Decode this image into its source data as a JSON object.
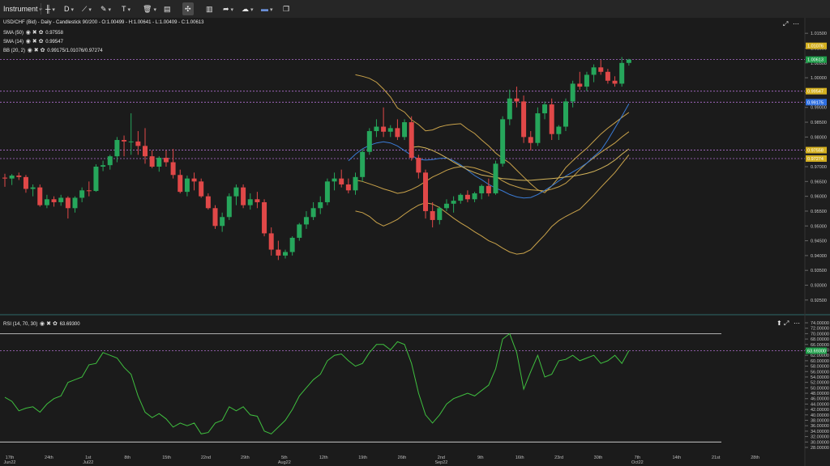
{
  "toolbar": {
    "instrument_label": "Instrument",
    "timeframe_label": "D",
    "icons": [
      "instrument-dropdown",
      "candles-icon",
      "timeframe-dropdown",
      "drawing-line-icon",
      "pencil-icon",
      "text-icon",
      "trash-icon",
      "layout-icon",
      "crosshair-icon",
      "bar-chart-icon",
      "share-icon",
      "weather-icon",
      "flag-uk-icon",
      "window-icon"
    ]
  },
  "colors": {
    "background": "#1b1b1b",
    "up": "#26a65b",
    "down": "#e04848",
    "bb": "#c9a24a",
    "sma50": "#d4b45a",
    "sma14": "#3a7bd5",
    "rsi": "#3fbf3f",
    "hline": "#b070d0"
  },
  "legend": {
    "title": "USD/CHF (Bid) - Daily - Candlestick  90/200 - O:1.00499 - H:1.00641 - L:1.00409 - C:1.00613",
    "sma50": "SMA (50)",
    "sma50_value": "0.97558",
    "sma14": "SMA (14)",
    "sma14_value": "0.99547",
    "bb": "BB (20, 2)",
    "bb_value": "0.99175/1.01076/0.97274",
    "rsi": "RSI (14, 70, 30)",
    "rsi_value": "63.69300"
  },
  "price_axis": {
    "ticks": [
      "1.01500",
      "1.01000",
      "1.00500",
      "1.00000",
      "0.99500",
      "0.99000",
      "0.98500",
      "0.98000",
      "0.97500",
      "0.97000",
      "0.96500",
      "0.96000",
      "0.95500",
      "0.95000",
      "0.94500",
      "0.94000",
      "0.93500",
      "0.93000",
      "0.92500"
    ],
    "badges": [
      {
        "text": "1.01076",
        "value": 1.01076,
        "color": "#d4b020"
      },
      {
        "text": "1.00613",
        "value": 1.00613,
        "color": "#1f9e4a"
      },
      {
        "text": "0.99547",
        "value": 0.99547,
        "color": "#d4b020"
      },
      {
        "text": "0.99175",
        "value": 0.99175,
        "color": "#2f6fe0"
      },
      {
        "text": "0.97558",
        "value": 0.97558,
        "color": "#d4b020"
      },
      {
        "text": "0.97274",
        "value": 0.97274,
        "color": "#d4b020"
      }
    ]
  },
  "rsi_axis": {
    "ticks": [
      "74.00000",
      "72.00000",
      "70.00000",
      "68.00000",
      "66.00000",
      "64.00000",
      "62.00000",
      "60.00000",
      "58.00000",
      "56.00000",
      "54.00000",
      "52.00000",
      "50.00000",
      "48.00000",
      "46.00000",
      "44.00000",
      "42.00000",
      "40.00000",
      "38.00000",
      "36.00000",
      "34.00000",
      "32.00000",
      "30.00000",
      "28.00000"
    ],
    "badge": {
      "text": "63.69300",
      "value": 63.693,
      "color": "#1f9e4a"
    }
  },
  "date_axis": {
    "labels": [
      "17th Jun22",
      "24th",
      "1st Jul22",
      "8th",
      "15th",
      "22nd",
      "29th",
      "5th Aug22",
      "12th",
      "19th",
      "26th",
      "2nd Sep22",
      "9th",
      "16th",
      "23rd",
      "30th",
      "7th Oct22",
      "14th",
      "21st",
      "28th"
    ]
  },
  "chart_data": {
    "type": "candlestick",
    "ylim": [
      0.9225,
      1.0175
    ],
    "rsi_ylim": [
      28,
      74
    ],
    "hlines_price": [
      1.00613,
      0.99547,
      0.99175,
      0.97558,
      0.97274
    ],
    "hlines_rsi": [
      70,
      63.693
    ],
    "candles": [
      [
        0.9663,
        0.9676,
        0.9632,
        0.966
      ],
      [
        0.966,
        0.9675,
        0.9638,
        0.967
      ],
      [
        0.967,
        0.968,
        0.9655,
        0.9665
      ],
      [
        0.9665,
        0.9672,
        0.9612,
        0.9625
      ],
      [
        0.9625,
        0.964,
        0.96,
        0.963
      ],
      [
        0.963,
        0.964,
        0.9565,
        0.957
      ],
      [
        0.957,
        0.9605,
        0.956,
        0.959
      ],
      [
        0.959,
        0.96,
        0.9565,
        0.958
      ],
      [
        0.958,
        0.9605,
        0.9568,
        0.9595
      ],
      [
        0.9595,
        0.96,
        0.9525,
        0.956
      ],
      [
        0.956,
        0.96,
        0.9545,
        0.9595
      ],
      [
        0.9595,
        0.963,
        0.958,
        0.962
      ],
      [
        0.962,
        0.965,
        0.96,
        0.9618
      ],
      [
        0.9618,
        0.9708,
        0.9615,
        0.97
      ],
      [
        0.97,
        0.972,
        0.9685,
        0.9705
      ],
      [
        0.9705,
        0.974,
        0.969,
        0.9735
      ],
      [
        0.9735,
        0.98,
        0.9715,
        0.979
      ],
      [
        0.979,
        0.9805,
        0.9735,
        0.9785
      ],
      [
        0.9785,
        0.988,
        0.974,
        0.9785
      ],
      [
        0.9785,
        0.982,
        0.974,
        0.977
      ],
      [
        0.977,
        0.983,
        0.971,
        0.9735
      ],
      [
        0.9735,
        0.9755,
        0.9695,
        0.97
      ],
      [
        0.97,
        0.9735,
        0.9683,
        0.973
      ],
      [
        0.973,
        0.9755,
        0.97,
        0.9715
      ],
      [
        0.9715,
        0.976,
        0.966,
        0.9672
      ],
      [
        0.9672,
        0.969,
        0.961,
        0.9615
      ],
      [
        0.9615,
        0.967,
        0.96,
        0.966
      ],
      [
        0.966,
        0.968,
        0.962,
        0.965
      ],
      [
        0.965,
        0.966,
        0.9595,
        0.96
      ],
      [
        0.96,
        0.961,
        0.9555,
        0.956
      ],
      [
        0.956,
        0.957,
        0.949,
        0.95
      ],
      [
        0.95,
        0.9545,
        0.948,
        0.953
      ],
      [
        0.953,
        0.961,
        0.952,
        0.96
      ],
      [
        0.96,
        0.964,
        0.957,
        0.963
      ],
      [
        0.963,
        0.964,
        0.956,
        0.957
      ],
      [
        0.957,
        0.961,
        0.9555,
        0.959
      ],
      [
        0.959,
        0.9615,
        0.956,
        0.958
      ],
      [
        0.958,
        0.959,
        0.9465,
        0.9475
      ],
      [
        0.9475,
        0.9495,
        0.94,
        0.942
      ],
      [
        0.942,
        0.945,
        0.9385,
        0.94
      ],
      [
        0.94,
        0.942,
        0.939,
        0.9412
      ],
      [
        0.9412,
        0.9465,
        0.94,
        0.946
      ],
      [
        0.946,
        0.951,
        0.945,
        0.9505
      ],
      [
        0.9505,
        0.955,
        0.949,
        0.953
      ],
      [
        0.953,
        0.958,
        0.952,
        0.956
      ],
      [
        0.956,
        0.96,
        0.954,
        0.958
      ],
      [
        0.958,
        0.966,
        0.957,
        0.965
      ],
      [
        0.965,
        0.968,
        0.962,
        0.966
      ],
      [
        0.966,
        0.969,
        0.963,
        0.964
      ],
      [
        0.964,
        0.966,
        0.961,
        0.962
      ],
      [
        0.962,
        0.968,
        0.9605,
        0.9665
      ],
      [
        0.9665,
        0.976,
        0.965,
        0.975
      ],
      [
        0.975,
        0.983,
        0.974,
        0.982
      ],
      [
        0.982,
        0.986,
        0.98,
        0.9835
      ],
      [
        0.9835,
        0.99,
        0.98,
        0.9818
      ],
      [
        0.9818,
        0.984,
        0.98,
        0.983
      ],
      [
        0.983,
        0.986,
        0.979,
        0.98
      ],
      [
        0.98,
        0.986,
        0.979,
        0.985
      ],
      [
        0.985,
        0.987,
        0.972,
        0.973
      ],
      [
        0.973,
        0.974,
        0.966,
        0.968
      ],
      [
        0.968,
        0.969,
        0.9525,
        0.955
      ],
      [
        0.955,
        0.958,
        0.9495,
        0.952
      ],
      [
        0.952,
        0.9565,
        0.9505,
        0.956
      ],
      [
        0.956,
        0.959,
        0.955,
        0.9575
      ],
      [
        0.9575,
        0.96,
        0.9545,
        0.9585
      ],
      [
        0.9585,
        0.961,
        0.9575,
        0.9605
      ],
      [
        0.9605,
        0.962,
        0.958,
        0.959
      ],
      [
        0.959,
        0.9615,
        0.958,
        0.961
      ],
      [
        0.961,
        0.964,
        0.959,
        0.9635
      ],
      [
        0.9635,
        0.966,
        0.96,
        0.961
      ],
      [
        0.961,
        0.972,
        0.9605,
        0.971
      ],
      [
        0.971,
        0.987,
        0.97,
        0.986
      ],
      [
        0.986,
        0.996,
        0.984,
        0.993
      ],
      [
        0.993,
        0.997,
        0.99,
        0.992
      ],
      [
        0.992,
        0.994,
        0.978,
        0.98
      ],
      [
        0.98,
        0.982,
        0.9755,
        0.978
      ],
      [
        0.978,
        0.99,
        0.977,
        0.988
      ],
      [
        0.988,
        0.992,
        0.986,
        0.991
      ],
      [
        0.991,
        0.993,
        0.979,
        0.981
      ],
      [
        0.981,
        0.984,
        0.979,
        0.9835
      ],
      [
        0.9835,
        0.993,
        0.982,
        0.992
      ],
      [
        0.992,
        0.999,
        0.99,
        0.998
      ],
      [
        0.998,
        1.002,
        0.996,
        0.997
      ],
      [
        0.997,
        1.002,
        0.9955,
        1.001
      ],
      [
        1.001,
        1.0045,
        0.9985,
        1.0035
      ],
      [
        1.0035,
        1.006,
        1.001,
        1.002
      ],
      [
        1.002,
        1.003,
        0.998,
        0.999
      ],
      [
        0.999,
        1.0005,
        0.997,
        0.998
      ],
      [
        0.998,
        1.007,
        0.997,
        1.005
      ],
      [
        1.005,
        1.0064,
        1.0041,
        1.00613
      ]
    ],
    "bb_upper": [
      1.001,
      1.0005,
      0.9998,
      0.9985,
      0.9962,
      0.9935,
      0.9898,
      0.9884,
      0.9858,
      0.9842,
      0.9821,
      0.9824,
      0.9834,
      0.984,
      0.9843,
      0.9845,
      0.9827,
      0.9812,
      0.979,
      0.977,
      0.9746,
      0.9728,
      0.9712,
      0.9688,
      0.9665,
      0.9642,
      0.9622,
      0.9612,
      0.9635,
      0.9664,
      0.9697,
      0.972,
      0.9742,
      0.9762,
      0.9786,
      0.981,
      0.983,
      0.9848,
      0.9866,
      0.9883
    ],
    "bb_mid": [
      0.9655,
      0.965,
      0.9642,
      0.9634,
      0.9625,
      0.9618,
      0.961,
      0.9614,
      0.9623,
      0.9635,
      0.965,
      0.9665,
      0.9676,
      0.9688,
      0.9696,
      0.97,
      0.97,
      0.9696,
      0.9688,
      0.968,
      0.9668,
      0.9652,
      0.964,
      0.9632,
      0.9625,
      0.9622,
      0.962,
      0.9618,
      0.9624,
      0.9632,
      0.9644,
      0.9665,
      0.969,
      0.9712,
      0.973,
      0.9748,
      0.9764,
      0.978,
      0.98,
      0.9818
    ],
    "bb_lower": [
      0.955,
      0.9545,
      0.9532,
      0.9512,
      0.95,
      0.951,
      0.9522,
      0.954,
      0.9556,
      0.957,
      0.9578,
      0.9574,
      0.9562,
      0.9544,
      0.9526,
      0.951,
      0.9496,
      0.948,
      0.9466,
      0.945,
      0.944,
      0.9425,
      0.9412,
      0.9405,
      0.9408,
      0.942,
      0.9445,
      0.947,
      0.9498,
      0.9518,
      0.9532,
      0.9544,
      0.9556,
      0.958,
      0.9604,
      0.963,
      0.9655,
      0.968,
      0.971,
      0.974
    ],
    "sma_fast": [
      0.972,
      0.9742,
      0.976,
      0.9772,
      0.978,
      0.9784,
      0.978,
      0.977,
      0.9754,
      0.9738,
      0.9725,
      0.9722,
      0.9724,
      0.9728,
      0.9729,
      0.972,
      0.9706,
      0.9688,
      0.967,
      0.9656,
      0.964,
      0.9628,
      0.9618,
      0.9606,
      0.9598,
      0.9594,
      0.9596,
      0.9606,
      0.962,
      0.9635,
      0.9652,
      0.9668,
      0.9682,
      0.9696,
      0.9712,
      0.9734,
      0.9755,
      0.979,
      0.983,
      0.987,
      0.9912
    ],
    "sma_slow": [
      0.9765,
      0.9768,
      0.9763,
      0.9755,
      0.9743,
      0.973,
      0.9715,
      0.9702,
      0.969,
      0.968,
      0.9672,
      0.9668,
      0.9664,
      0.966,
      0.9658,
      0.9655,
      0.9654,
      0.9654,
      0.9656,
      0.9658,
      0.966,
      0.9662,
      0.9665,
      0.9668,
      0.9672,
      0.9677,
      0.9684,
      0.9694,
      0.9706,
      0.9722,
      0.9742,
      0.976
    ],
    "rsi": [
      46.5,
      45,
      41.5,
      42.5,
      43,
      41,
      44,
      46,
      47,
      52,
      53,
      54,
      58.5,
      59,
      63,
      62,
      61,
      57.5,
      55,
      47,
      41,
      39,
      40.5,
      38.5,
      35.5,
      37,
      36,
      37,
      33,
      33.5,
      37,
      38,
      43,
      41.5,
      43,
      40,
      39.5,
      34,
      33,
      35.5,
      38,
      42,
      47,
      50,
      53,
      55,
      60,
      62,
      62.5,
      60,
      58,
      59,
      63,
      66,
      66,
      64,
      67,
      66,
      59,
      48,
      40,
      37,
      40,
      44,
      46,
      47,
      48,
      47,
      49,
      51,
      57,
      68,
      70,
      63,
      49.5,
      56,
      62,
      54,
      55,
      60,
      60.5,
      62,
      60,
      61,
      62,
      59,
      60,
      62,
      59,
      63.693
    ]
  }
}
